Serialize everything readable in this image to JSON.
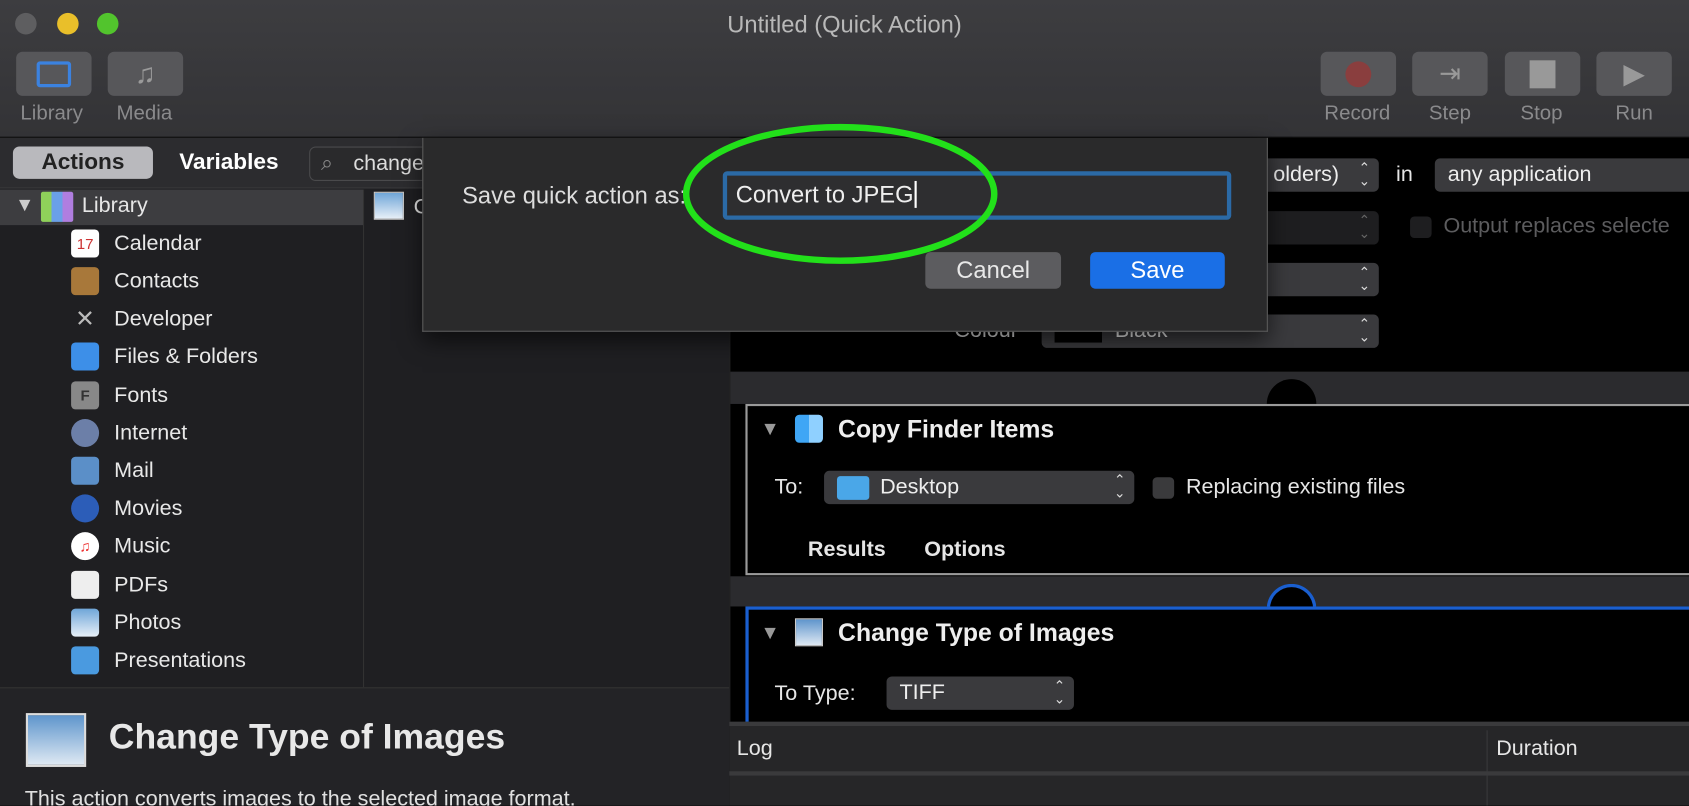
{
  "window": {
    "title": "Untitled (Quick Action)"
  },
  "toolbar": {
    "left": [
      {
        "label": "Library",
        "icon": "library-icon"
      },
      {
        "label": "Media",
        "icon": "media-icon"
      }
    ],
    "right": [
      {
        "label": "Record",
        "icon": "record-icon"
      },
      {
        "label": "Step",
        "icon": "step-icon"
      },
      {
        "label": "Stop",
        "icon": "stop-icon"
      },
      {
        "label": "Run",
        "icon": "run-icon"
      }
    ]
  },
  "library": {
    "tabs": {
      "actions": "Actions",
      "variables": "Variables"
    },
    "search_value": "change",
    "root": "Library",
    "items": [
      "Calendar",
      "Contacts",
      "Developer",
      "Files & Folders",
      "Fonts",
      "Internet",
      "Mail",
      "Movies",
      "Music",
      "PDFs",
      "Photos",
      "Presentations"
    ],
    "result_partial": "C"
  },
  "description": {
    "title": "Change Type of Images",
    "text": "This action converts images to the selected image format."
  },
  "workflow": {
    "top_action": {
      "receives_partial": "olders)",
      "in_label": "in",
      "application": "any application",
      "output_replaces": "Output replaces selecte",
      "colour_label": "Colour",
      "colour_value": "Black"
    },
    "copy_finder": {
      "title": "Copy Finder Items",
      "to_label": "To:",
      "to_value": "Desktop",
      "replacing": "Replacing existing files",
      "results": "Results",
      "options": "Options"
    },
    "change_type": {
      "title": "Change Type of Images",
      "to_type_label": "To Type:",
      "to_type_value": "TIFF"
    }
  },
  "log": {
    "col_log": "Log",
    "col_duration": "Duration"
  },
  "dialog": {
    "label": "Save quick action as:",
    "value": "Convert to JPEG",
    "cancel": "Cancel",
    "save": "Save"
  },
  "colors": {
    "accent": "#1a6fe6",
    "highlight_ellipse": "#22e01a"
  }
}
